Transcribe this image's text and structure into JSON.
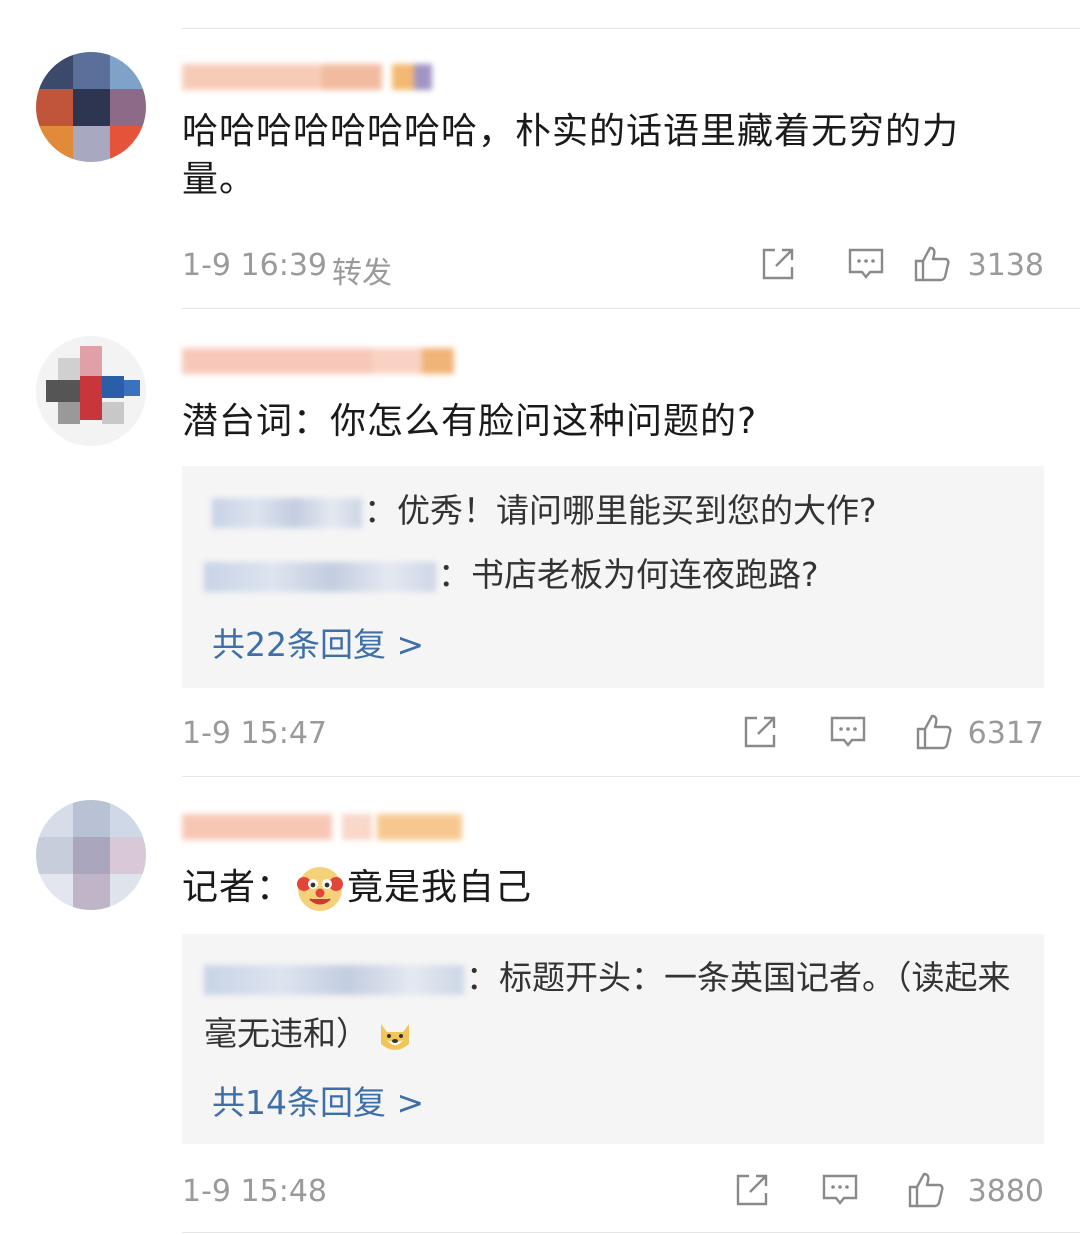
{
  "comments": [
    {
      "text": "哈哈哈哈哈哈哈哈，朴实的话语里藏着无穷的力量。",
      "time": "1-9 16:39",
      "extra_action": "转发",
      "likes": "3138",
      "replies": null
    },
    {
      "text": "潜台词：你怎么有脸问这种问题的?",
      "time": "1-9 15:47",
      "likes": "6317",
      "replies": {
        "items": [
          {
            "name_tail": "：",
            "text": "优秀！请问哪里能买到您的大作?"
          },
          {
            "name_tail": "：",
            "text": "书店老板为何连夜跑路?"
          }
        ],
        "more": "共22条回复 >"
      }
    },
    {
      "text_prefix": "记者：",
      "emoji": "clown-emoji",
      "text_suffix": "竟是我自己",
      "time": "1-9 15:48",
      "likes": "3880",
      "replies": {
        "items": [
          {
            "name_tail": "：",
            "text": "标题开头：一条英国记者。（读起来毫无违和）",
            "emoji": "doge-emoji"
          }
        ],
        "more": "共14条回复 >"
      }
    }
  ],
  "icons": {
    "share": "share-icon",
    "comment": "comment-icon",
    "like": "thumbs-up-icon"
  },
  "colors": {
    "link": "#3e6fa8",
    "meta": "#9a9a9a",
    "reply_bg": "#f5f5f5"
  }
}
